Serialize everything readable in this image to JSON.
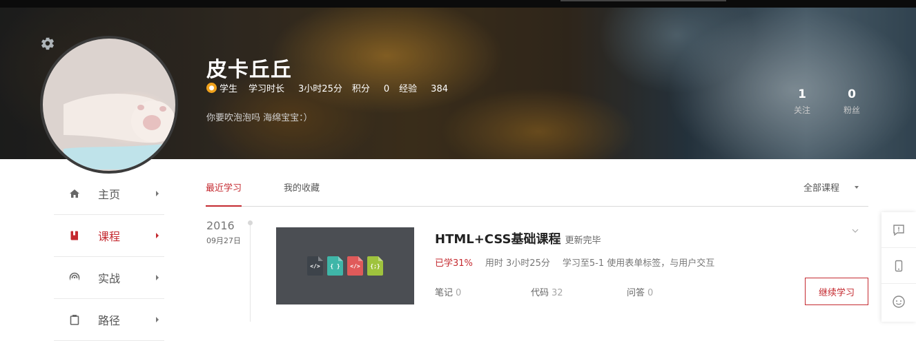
{
  "profile": {
    "name": "皮卡丘丘",
    "role": "学生",
    "study_time_label": "学习时长",
    "study_time_value": "3小时25分",
    "points_label": "积分",
    "points_value": "0",
    "exp_label": "经验",
    "exp_value": "384",
    "signature": "你要吹泡泡吗 海绵宝宝：）",
    "follow_count": "1",
    "follow_label": "关注",
    "fans_count": "0",
    "fans_label": "粉丝"
  },
  "icons": {
    "settings": "gear-icon",
    "role_badge": "student-badge-icon"
  },
  "sidebar": {
    "items": [
      {
        "label": "主页",
        "icon": "home-icon"
      },
      {
        "label": "课程",
        "icon": "book-icon",
        "active": true
      },
      {
        "label": "实战",
        "icon": "practice-icon"
      },
      {
        "label": "路径",
        "icon": "path-icon"
      }
    ]
  },
  "tabs": {
    "items": [
      {
        "label": "最近学习",
        "active": true
      },
      {
        "label": "我的收藏"
      }
    ],
    "filter": "全部课程"
  },
  "timeline": {
    "year": "2016",
    "date": "09月27日"
  },
  "course": {
    "title": "HTML+CSS基础课程",
    "status": "更新完毕",
    "progress": "已学31%",
    "time_spent": "用时 3小时25分",
    "last_lesson": "学习至5-1 使用表单标签，与用户交互",
    "notes_label": "笔记",
    "notes_count": "0",
    "code_label": "代码",
    "code_count": "32",
    "qa_label": "问答",
    "qa_count": "0",
    "continue_label": "继续学习",
    "thumb_icons": [
      "</>",
      "{ }",
      "</>",
      "{;}"
    ]
  },
  "colors": {
    "accent": "#c4292f",
    "badge": "#f0a21c",
    "thumb_bg": "#4b4e53",
    "file_colors": [
      "#3d434a",
      "#3fb6a8",
      "#e05a5a",
      "#9fc33d"
    ]
  },
  "float_toolbar": [
    "feedback-icon",
    "mobile-icon",
    "chat-icon"
  ]
}
